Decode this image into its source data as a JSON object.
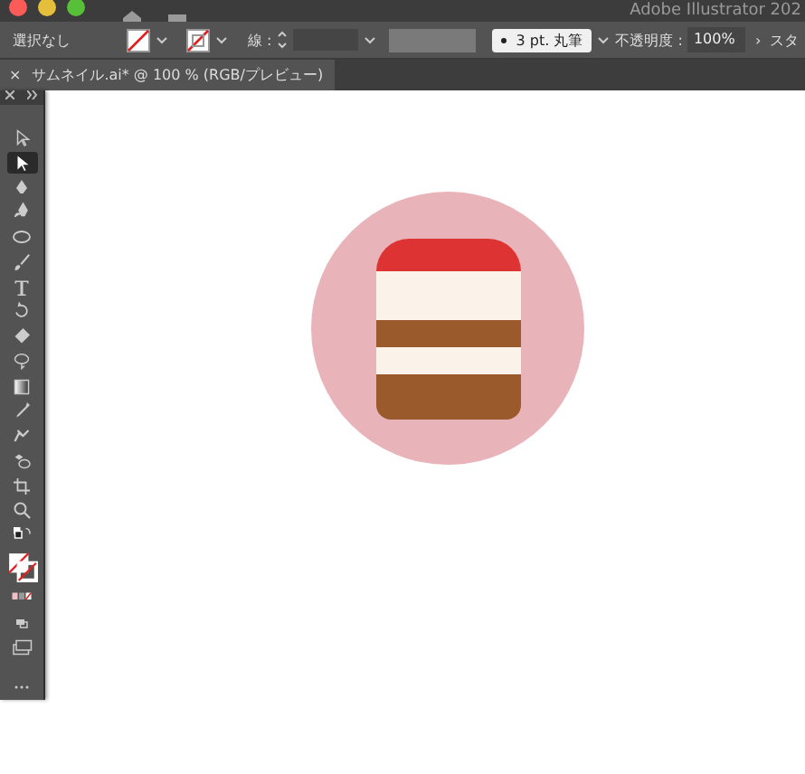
{
  "window": {
    "title": "Adobe Illustrator 202"
  },
  "control_bar": {
    "selection": "選択なし",
    "stroke_label": "線 :",
    "brush": "3 pt. 丸筆",
    "opacity_label": "不透明度 :",
    "opacity": "100%",
    "more": "›",
    "style_label": "スタ"
  },
  "document_tabs": [
    {
      "close": "×",
      "title": "サムネイル.ai* @ 100 % (RGB/プレビュー)",
      "selected": true
    }
  ],
  "tools": [
    {
      "kind": "select",
      "selected": false
    },
    {
      "kind": "direct",
      "selected": true
    },
    {
      "kind": "pen",
      "selected": false
    },
    {
      "kind": "curvature",
      "selected": false
    },
    {
      "kind": "ellipse",
      "selected": false
    },
    {
      "kind": "brush",
      "selected": false
    },
    {
      "kind": "type",
      "selected": false
    },
    {
      "kind": "rotate",
      "selected": false
    },
    {
      "kind": "eraser",
      "selected": false
    },
    {
      "kind": "lasso",
      "selected": false
    },
    {
      "kind": "gradient",
      "selected": false
    },
    {
      "kind": "eyedropper",
      "selected": false
    },
    {
      "kind": "puppet",
      "selected": false
    },
    {
      "kind": "shapebuilder",
      "selected": false
    },
    {
      "kind": "artboard",
      "selected": false
    },
    {
      "kind": "zoom",
      "selected": false
    },
    {
      "kind": "swap",
      "selected": false
    },
    {
      "kind": "fillstroke",
      "selected": false
    },
    {
      "kind": "colormode",
      "selected": false
    },
    {
      "kind": "drawmode",
      "selected": false
    },
    {
      "kind": "screenmode",
      "selected": false
    },
    {
      "kind": "more",
      "selected": false
    }
  ]
}
